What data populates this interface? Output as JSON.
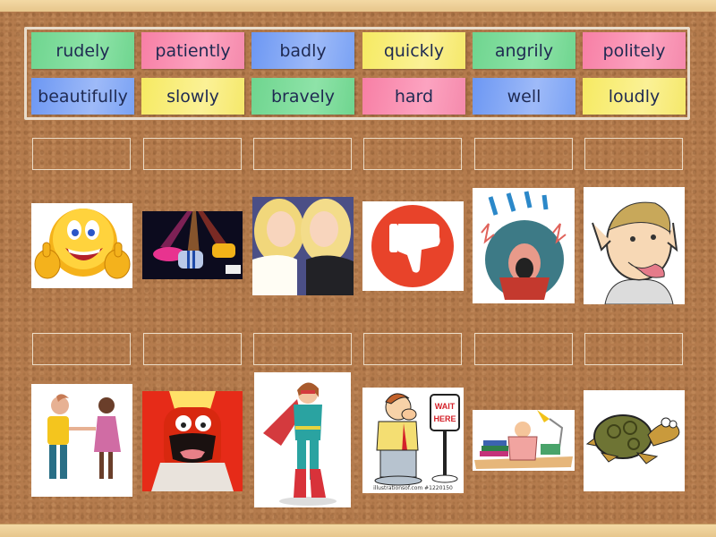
{
  "activity": {
    "type": "match-up",
    "word_bank": [
      {
        "label": "rudely",
        "color": "green"
      },
      {
        "label": "patiently",
        "color": "pink"
      },
      {
        "label": "badly",
        "color": "blue"
      },
      {
        "label": "quickly",
        "color": "yellow"
      },
      {
        "label": "angrily",
        "color": "green"
      },
      {
        "label": "politely",
        "color": "pink"
      },
      {
        "label": "beautifully",
        "color": "blue"
      },
      {
        "label": "slowly",
        "color": "yellow"
      },
      {
        "label": "bravely",
        "color": "green"
      },
      {
        "label": "hard",
        "color": "pink"
      },
      {
        "label": "well",
        "color": "blue"
      },
      {
        "label": "loudly",
        "color": "yellow"
      }
    ],
    "images": [
      {
        "name": "thumbs-up-smiley-image"
      },
      {
        "name": "racing-cars-image"
      },
      {
        "name": "two-blonde-dolls-image"
      },
      {
        "name": "thumbs-down-icon-image"
      },
      {
        "name": "shouting-man-music-image"
      },
      {
        "name": "boy-sticking-tongue-out-image"
      },
      {
        "name": "children-shaking-hands-image"
      },
      {
        "name": "angry-red-character-image"
      },
      {
        "name": "superhero-woman-image"
      },
      {
        "name": "man-waiting-sign-image",
        "sign_text": "WAIT HERE",
        "credit": "illustrationsof.com   #1220150"
      },
      {
        "name": "child-studying-desk-image"
      },
      {
        "name": "tortoise-walking-image"
      }
    ]
  },
  "colors": {
    "green": "#7ddc9b",
    "pink": "#f990b3",
    "blue": "#86a9f5",
    "yellow": "#f8ec7c",
    "cork": "#b47b4d",
    "frame": "#efd39c",
    "text": "#1f2a52"
  }
}
